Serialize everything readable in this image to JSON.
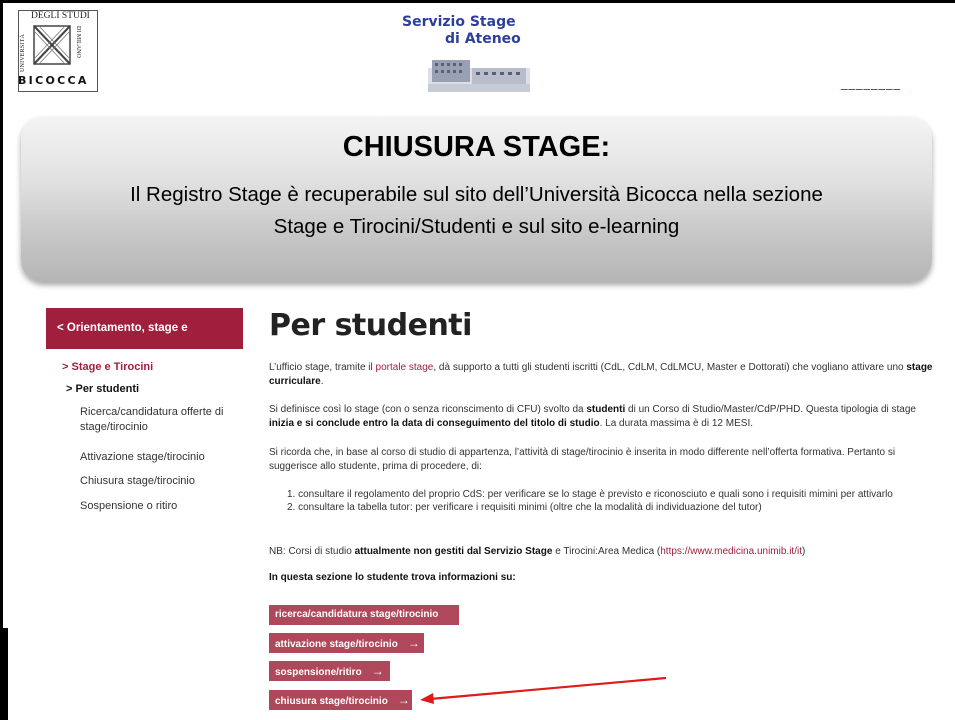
{
  "logo": {
    "degli_studi": "DEGLI STUDI",
    "universita": "UNIVERSITÀ",
    "di_milano": "DI MILANO",
    "bicocca": "BICOCCA"
  },
  "servizio": {
    "line1": "Servizio Stage",
    "line2": "di Ateneo"
  },
  "banner": {
    "title": "CHIUSURA STAGE:",
    "text_line1": "Il Registro Stage è recuperabile sul sito dell’Università Bicocca nella sezione",
    "text_line2": "Stage e Tirocini/Studenti e sul sito e-learning"
  },
  "sidebar": {
    "header": "< Orientamento, stage e placement",
    "items": [
      {
        "label": "> Stage e Tirocini"
      },
      {
        "label": "> Per studenti"
      },
      {
        "label": "Ricerca/candidatura offerte di"
      },
      {
        "label": "stage/tirocinio"
      },
      {
        "label": "Attivazione stage/tirocinio"
      },
      {
        "label": "Chiusura stage/tirocinio"
      },
      {
        "label": "Sospensione o ritiro"
      }
    ]
  },
  "main": {
    "title": "Per studenti",
    "p1_a": "L’ufficio stage, tramite il ",
    "p1_link": "portale stage",
    "p1_b": ", dà supporto a tutti gli studenti iscritti (CdL, CdLM, CdLMCU, Master e Dottorati) che vogliano attivare uno ",
    "p1_bold": "stage curriculare",
    "p1_end": ".",
    "p2_a": "Si definisce così lo stage (con o senza riconscimento di CFU) svolto da ",
    "p2_bold1": "studenti",
    "p2_b": " di un Corso di Studio/Master/CdP/PHD. Questa tipologia di stage ",
    "p2_bold2": "inizia e si conclude entro la data di conseguimento del titolo di studio",
    "p2_c": ". La durata massima è di 12 MESI.",
    "p3": "Si ricorda che, in base al corso di studio di appartenza, l’attività di stage/tirocinio è inserita in modo differente nell’offerta formativa. Pertanto si suggerisce allo studente, prima di procedere, di:",
    "list1": "1. consultare il regolamento del proprio CdS: per verificare se lo stage è previsto e riconosciuto e quali sono i requisiti mimini per attivarlo",
    "list2": "2. consultare la tabella tutor: per verificare i requisiti minimi (oltre che la modalità di individuazione del tutor)",
    "nb_a": "NB: Corsi di studio ",
    "nb_bold": "attualmente non gestiti dal Servizio Stage",
    "nb_b": " e Tirocini:Area Medica (",
    "nb_link": "https://www.medicina.unimib.it/it",
    "nb_end": ")",
    "section_label": "In questa sezione lo studente trova informazioni su:",
    "buttons": [
      {
        "label": "ricerca/candidatura stage/tirocinio"
      },
      {
        "label": "attivazione stage/tirocinio"
      },
      {
        "label": "sospensione/ritiro"
      },
      {
        "label": "chiusura stage/tirocinio"
      }
    ],
    "arrow_glyph": "→"
  },
  "colors": {
    "accent": "#a01f3c",
    "button": "#b0485b",
    "annotation_arrow": "#e01a1a"
  }
}
